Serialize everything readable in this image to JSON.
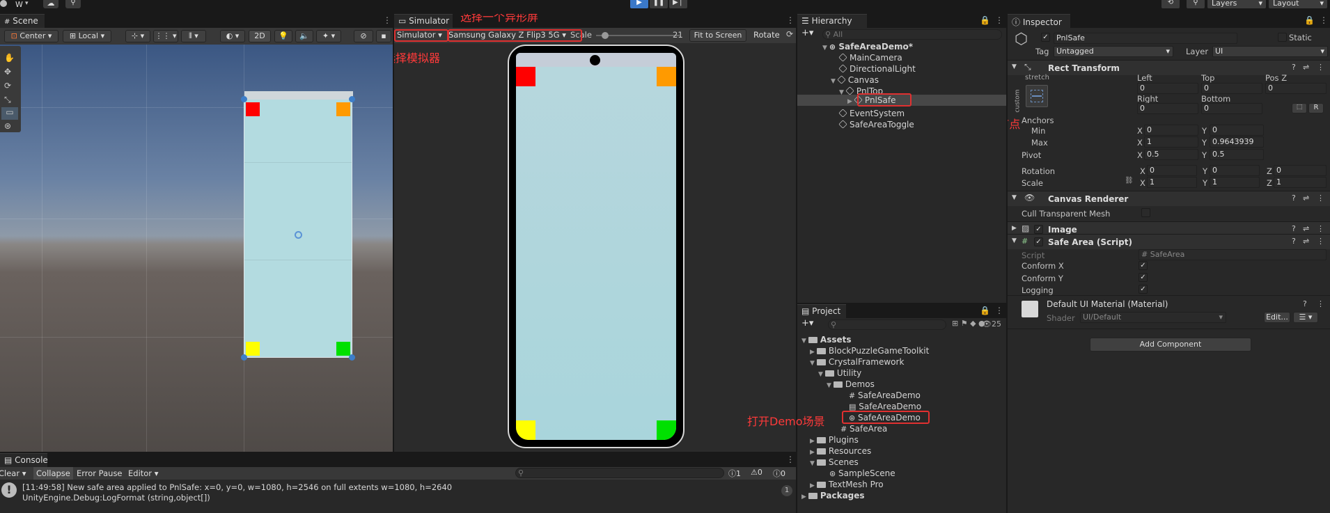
{
  "toolbar": {
    "account": "W",
    "layers": "Layers",
    "layout": "Layout"
  },
  "scene": {
    "tab": "Scene",
    "pivot": "Center",
    "space": "Local",
    "mode2d": "2D"
  },
  "simulator": {
    "tab": "Simulator",
    "view": "Simulator",
    "device": "Samsung Galaxy Z Flip3 5G",
    "scale_label": "Scale",
    "scale_value": "21",
    "fit": "Fit to Screen",
    "rotate": "Rotate"
  },
  "annotations": {
    "pick_notch": "选择一个异形屏",
    "pick_sim": "选择模拟器",
    "pick_node": "选择SafeArea脚本挂载的节点",
    "open_demo": "打开Demo场景"
  },
  "hierarchy": {
    "tab": "Hierarchy",
    "search": "All",
    "items": [
      "SafeAreaDemo*",
      "MainCamera",
      "DirectionalLight",
      "Canvas",
      "PnlTop",
      "PnlSafe",
      "EventSystem",
      "SafeAreaToggle"
    ]
  },
  "project": {
    "tab": "Project",
    "count": "25",
    "items": [
      "Assets",
      "BlockPuzzleGameToolkit",
      "CrystalFramework",
      "Utility",
      "Demos",
      "SafeAreaDemo",
      "SafeAreaDemo",
      "SafeAreaDemo",
      "SafeArea",
      "Plugins",
      "Resources",
      "Scenes",
      "SampleScene",
      "TextMesh Pro",
      "Packages"
    ]
  },
  "inspector": {
    "tab": "Inspector",
    "name": "PnlSafe",
    "static": "Static",
    "tag_label": "Tag",
    "tag": "Untagged",
    "layer_label": "Layer",
    "layer": "UI",
    "rect": {
      "title": "Rect Transform",
      "stretch": "stretch",
      "custom": "custom",
      "left_l": "Left",
      "top_l": "Top",
      "posz_l": "Pos Z",
      "left": "0",
      "top": "0",
      "posz": "0",
      "right_l": "Right",
      "bottom_l": "Bottom",
      "right": "0",
      "bottom": "0",
      "anchors": "Anchors",
      "min": "Min",
      "max": "Max",
      "min_x": "0",
      "min_y": "0",
      "max_x": "1",
      "max_y": "0.9643939",
      "pivot": "Pivot",
      "pivot_x": "0.5",
      "pivot_y": "0.5",
      "rotation": "Rotation",
      "rot_x": "0",
      "rot_y": "0",
      "rot_z": "0",
      "scale": "Scale",
      "scale_x": "1",
      "scale_y": "1",
      "scale_z": "1",
      "r_btn": "R",
      "x": "X",
      "y": "Y",
      "z": "Z"
    },
    "canvas_renderer": "Canvas Renderer",
    "cull": "Cull Transparent Mesh",
    "image": "Image",
    "safe_area": {
      "title": "Safe Area (Script)",
      "script_l": "Script",
      "script": "SafeArea",
      "conform_x": "Conform X",
      "conform_y": "Conform Y",
      "logging": "Logging"
    },
    "material": "Default UI Material (Material)",
    "shader_l": "Shader",
    "shader": "UI/Default",
    "edit": "Edit...",
    "add_component": "Add Component"
  },
  "console": {
    "tab": "Console",
    "clear": "Clear",
    "collapse": "Collapse",
    "error_pause": "Error Pause",
    "editor": "Editor",
    "count_log": "1",
    "count_warn": "0",
    "count_err": "0",
    "line1": "[11:49:58] New safe area applied to PnlSafe: x=0, y=0, w=1080, h=2546 on full extents w=1080, h=2640",
    "line2": "UnityEngine.Debug:LogFormat (string,object[])",
    "badge": "1"
  },
  "colors": {
    "red": "#ff0000",
    "orange": "#ff9a00",
    "yellow": "#ffff00",
    "green": "#00e000",
    "safe": "#b3dbe0",
    "annotation": "#e03030"
  }
}
